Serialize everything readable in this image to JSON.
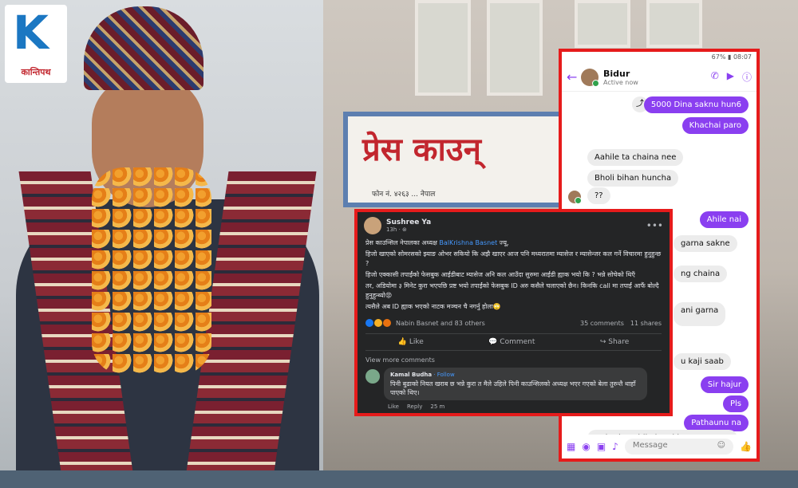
{
  "logo": {
    "letter": "K",
    "text": "कान्तिपथ"
  },
  "sign": {
    "text": "प्रेस काउन्",
    "subtext": "फोन नं. ४२६३ ... नेपाल"
  },
  "messenger": {
    "status_left": "",
    "status_right": "67% ▮ 08:07",
    "contact_name": "Bidur",
    "contact_status": "Active now",
    "messages": [
      {
        "dir": "out",
        "text": "5000 Dina saknu hun6"
      },
      {
        "dir": "out",
        "text": "Khachai paro"
      },
      {
        "dir": "in",
        "text": "Aahile ta chaina nee"
      },
      {
        "dir": "in",
        "text": "Bholi bihan huncha"
      },
      {
        "dir": "in",
        "text": "??"
      },
      {
        "dir": "out",
        "text": "Ahile nai"
      },
      {
        "dir": "in",
        "text": "garna sakne"
      },
      {
        "dir": "in",
        "text": "ng chaina"
      },
      {
        "dir": "in",
        "text": "ani garna"
      },
      {
        "dir": "in",
        "text": "u kaji saab"
      },
      {
        "dir": "out",
        "text": "Sir hajur"
      },
      {
        "dir": "out",
        "text": "Pls"
      },
      {
        "dir": "out",
        "text": "Pathaunu na"
      },
      {
        "dir": "in",
        "text": "Hajur le aahile katai bata manage"
      }
    ],
    "input_placeholder": "Message"
  },
  "facebook": {
    "author": "Sushree Ya",
    "time": "13h · ⊛",
    "line1_pre": "प्रेस काउन्सिल नेपालका अध्यक्ष ",
    "line1_link": "BalKrishna Basnet",
    "line1_post": " ज्यू,",
    "line2": "हिजो खाएको सोमरसको झ्याङ ओभर सकियो कि अझै खाएर आज पनि मध्यरातमा म्यासेज र म्यासेन्जर कल गर्ने विचारमा हुनुहुन्छ ?",
    "line3": "हिजो एक्कासी तपाईंको फेसबुक आईडीबाट म्यासेज अनि कल आउँदा सुरुमा आईडी ह्याक भयो कि ? भन्ने सोचेको थिएँ",
    "line4": "तर, अडियोमा ३ मिनेट कुरा भएपछि प्रष्ट भयो तपाईंको फेसबुक ID अरु कसैले चलाएको छैन। किनकि call मा तपाईं आफैं बोल्दै हुनुहुन्थ्यो😡",
    "line5": "त्यसैले अब ID ह्याक भएको नाटक मञ्चन चै नगर्नु होला🙄",
    "reactions_text": "Nabin Basnet and 83 others",
    "comments_count": "35 comments",
    "shares_count": "11 shares",
    "action_like": "Like",
    "action_comment": "Comment",
    "action_share": "Share",
    "view_more": "View more comments",
    "comment_author": "Kamal Budha",
    "comment_follow": " · Follow",
    "comment_text": "पिनी बुढाको नियत खराब छ भन्ने कुरा त मैले उहिले पिनी काउन्सिलको अध्यक्ष भएर गएको बेला तुरुन्तै थाहाँ पाएको थिए।",
    "comment_like": "Like",
    "comment_reply": "Reply",
    "comment_time": "25 m"
  }
}
